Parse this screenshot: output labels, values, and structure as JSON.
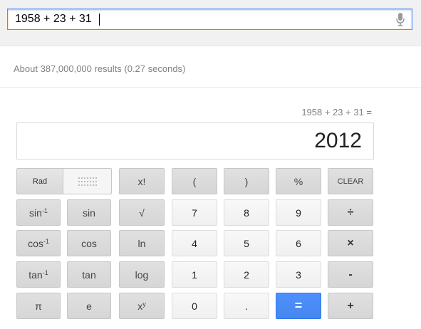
{
  "search": {
    "value": "1958 + 23 + 31"
  },
  "results_stats": "About 387,000,000 results (0.27 seconds)",
  "calculator": {
    "expression": "1958 + 23 + 31 =",
    "result": "2012",
    "rad_label": "Rad",
    "buttons": {
      "factorial": "x!",
      "lparen": "(",
      "rparen": ")",
      "percent": "%",
      "clear": "CLEAR",
      "asin_base": "sin",
      "asin_sup": "-1",
      "sin": "sin",
      "sqrt": "√",
      "n7": "7",
      "n8": "8",
      "n9": "9",
      "divide": "÷",
      "acos_base": "cos",
      "acos_sup": "-1",
      "cos": "cos",
      "ln": "ln",
      "n4": "4",
      "n5": "5",
      "n6": "6",
      "multiply": "×",
      "atan_base": "tan",
      "atan_sup": "-1",
      "tan": "tan",
      "log": "log",
      "n1": "1",
      "n2": "2",
      "n3": "3",
      "minus": "-",
      "pi": "π",
      "e": "e",
      "pow_base": "x",
      "pow_sup": "y",
      "n0": "0",
      "dot": ".",
      "equals": "=",
      "plus": "+"
    }
  },
  "colors": {
    "accent": "#4d90fe",
    "topbar": "#f1f1f1",
    "muted_text": "#808080"
  }
}
